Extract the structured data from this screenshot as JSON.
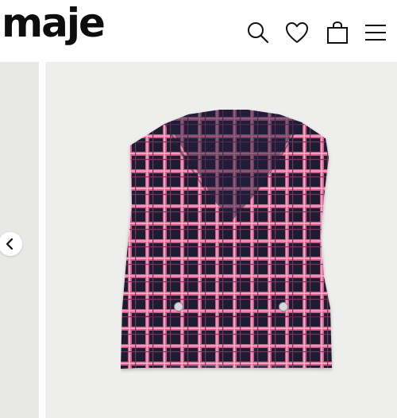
{
  "brand": {
    "logo_text": "maje"
  },
  "header": {
    "icons": [
      "search-icon",
      "heart-icon",
      "shopping-bag-icon",
      "menu-icon"
    ]
  },
  "carousel": {
    "prev_icon": "chevron-left-icon",
    "product": {
      "name": "plaid-tweed-vest"
    }
  },
  "colors": {
    "navy": "#1c1a33",
    "pink": "#e0608f",
    "light_pink": "#f3b8cc",
    "background": "#eeeeec"
  }
}
